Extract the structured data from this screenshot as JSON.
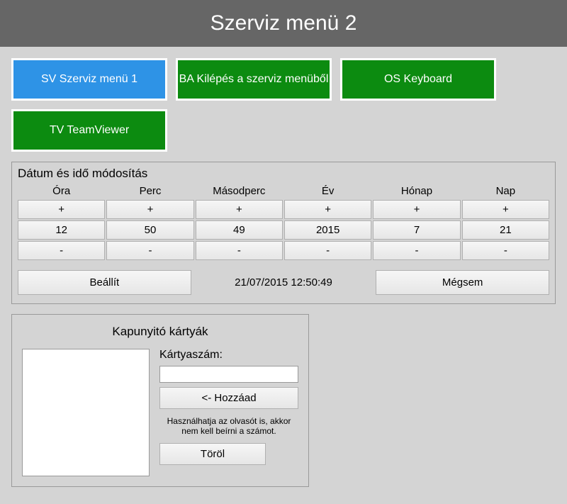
{
  "header": {
    "title": "Szerviz menü 2"
  },
  "buttons": {
    "service_menu_1": "SV Szerviz menü 1",
    "exit_service": "BA Kilépés a szerviz menüből",
    "os_keyboard": "OS Keyboard",
    "teamviewer": "TV TeamViewer"
  },
  "datetime": {
    "panel_title": "Dátum és idő módosítás",
    "headers": {
      "hour": "Óra",
      "minute": "Perc",
      "second": "Másodperc",
      "year": "Év",
      "month": "Hónap",
      "day": "Nap"
    },
    "plus": "+",
    "minus": "-",
    "values": {
      "hour": "12",
      "minute": "50",
      "second": "49",
      "year": "2015",
      "month": "7",
      "day": "21"
    },
    "set_label": "Beállít",
    "timestamp": "21/07/2015 12:50:49",
    "cancel_label": "Mégsem"
  },
  "cards": {
    "panel_title": "Kapunyitó kártyák",
    "card_number_label": "Kártyaszám:",
    "card_number_value": "",
    "add_label": "<- Hozzáad",
    "hint": "Használhatja az olvasót is, akkor nem kell beírni a számot.",
    "delete_label": "Töröl"
  }
}
